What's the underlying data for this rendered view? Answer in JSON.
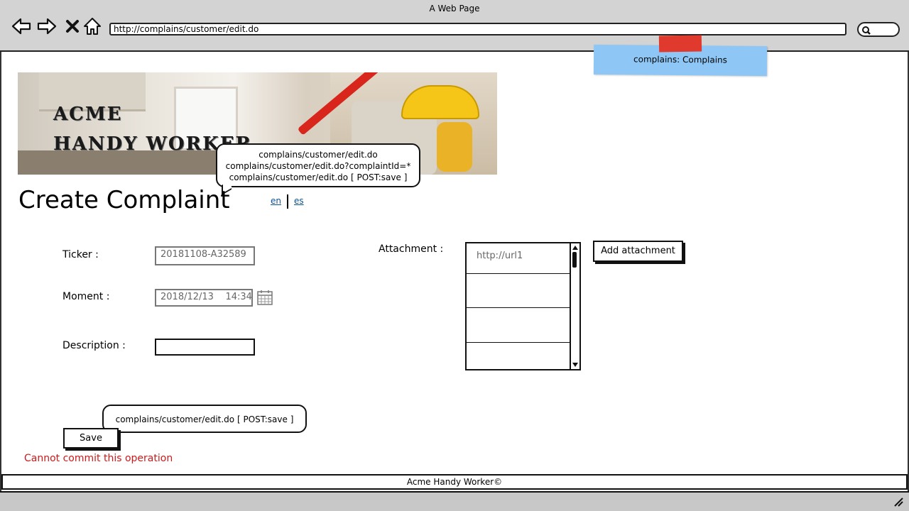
{
  "window": {
    "title": "A Web Page"
  },
  "browser": {
    "url": "http://complains/customer/edit.do",
    "icons": [
      "back-arrow-icon",
      "forward-arrow-icon",
      "close-x-icon",
      "home-icon",
      "search-icon"
    ]
  },
  "note": {
    "text": "complains: Complains",
    "color": "#8ec7f5",
    "tape_color": "#e03a2f"
  },
  "banner": {
    "logo_line1": "ACME",
    "logo_line2": "HANDY WORKER"
  },
  "bubble_top": {
    "lines": [
      "complains/customer/edit.do",
      "complains/customer/edit.do?complaintId=*",
      "complains/customer/edit.do [ POST:save ]"
    ]
  },
  "page": {
    "title": "Create Complaint",
    "lang_en": "en",
    "lang_es": "es"
  },
  "form": {
    "ticker_label": "Ticker :",
    "ticker_value": "20181108-A32589",
    "moment_label": "Moment :",
    "moment_value": "2018/12/13    14:34",
    "description_label": "Description :",
    "description_value": "",
    "attachment_label": "Attachment :",
    "attachments": [
      "http://url1",
      "",
      "",
      ""
    ],
    "add_attachment_label": "Add attachment",
    "save_label": "Save",
    "error_text": "Cannot commit this operation",
    "error_color": "#cc1a1a"
  },
  "bubble_bottom": {
    "text": "complains/customer/edit.do [ POST:save ]"
  },
  "footer": {
    "text": "Acme Handy Worker©"
  }
}
